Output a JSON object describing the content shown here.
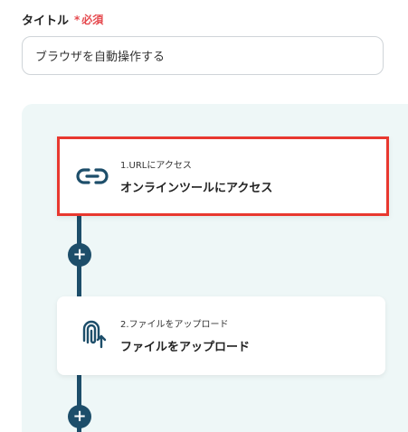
{
  "title_field": {
    "label": "タイトル",
    "required_star": "*",
    "required_text": "必須",
    "value": "ブラウザを自動操作する"
  },
  "steps": [
    {
      "sub_label": "1.URLにアクセス",
      "main_label": "オンラインツールにアクセス",
      "icon": "link-icon"
    },
    {
      "sub_label": "2.ファイルをアップロード",
      "main_label": "ファイルをアップロード",
      "icon": "paperclip-upload-icon"
    }
  ],
  "add_button_glyph": "+",
  "colors": {
    "accent": "#1d4e6a",
    "required": "#e5484d",
    "selection": "#e8382f",
    "canvas": "#eef7f7"
  }
}
